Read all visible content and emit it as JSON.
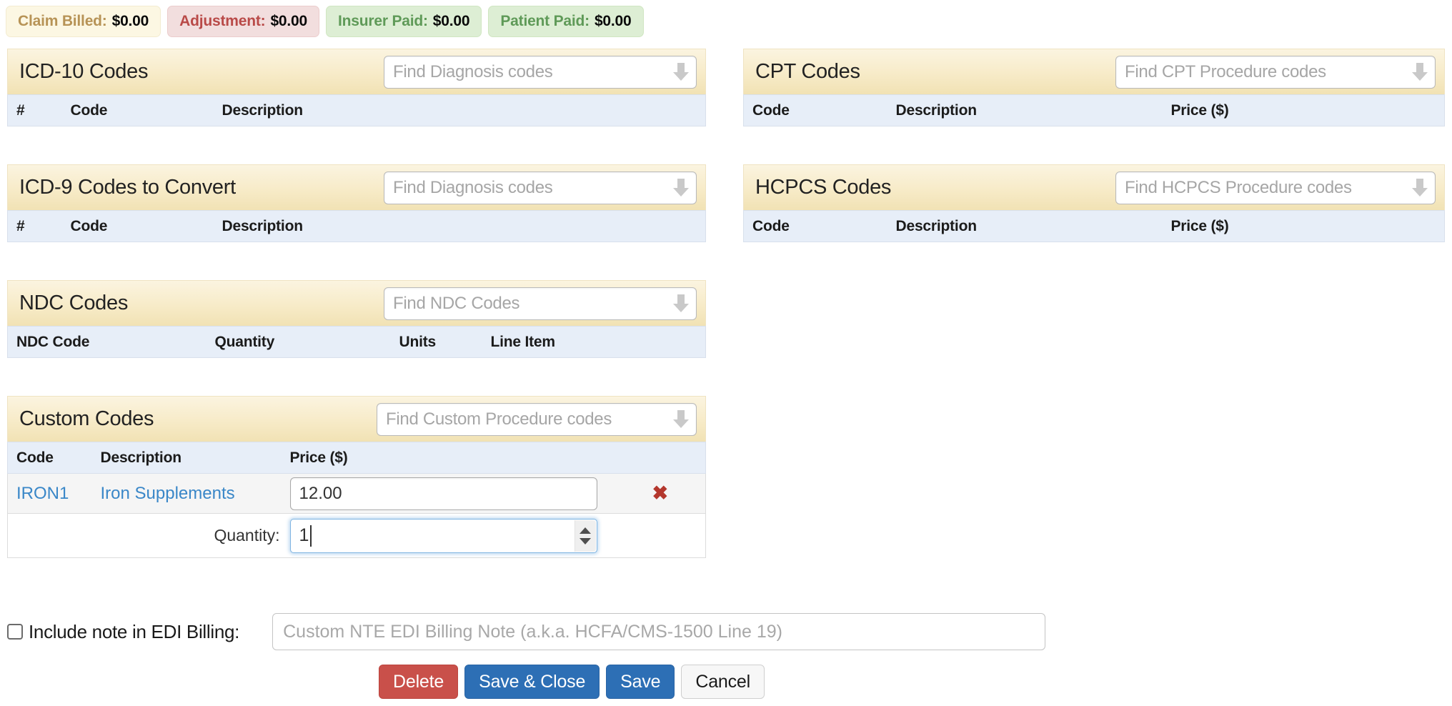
{
  "summary": {
    "badges": [
      {
        "label": "Claim Billed:",
        "amount": "$0.00",
        "tone": "cream",
        "color": "#b79356"
      },
      {
        "label": "Adjustment:",
        "amount": "$0.00",
        "tone": "pink",
        "color": "#b94a48"
      },
      {
        "label": "Insurer Paid:",
        "amount": "$0.00",
        "tone": "green",
        "color": "#5f9a58"
      },
      {
        "label": "Patient Paid:",
        "amount": "$0.00",
        "tone": "green",
        "color": "#5f9a58"
      }
    ]
  },
  "panels": {
    "icd10": {
      "title": "ICD-10 Codes",
      "search_placeholder": "Find Diagnosis codes",
      "columns": [
        "#",
        "Code",
        "Description"
      ],
      "rows": []
    },
    "cpt": {
      "title": "CPT Codes",
      "search_placeholder": "Find CPT Procedure codes",
      "columns": [
        "Code",
        "Description",
        "Price ($)"
      ],
      "rows": []
    },
    "icd9": {
      "title": "ICD-9 Codes to Convert",
      "search_placeholder": "Find Diagnosis codes",
      "columns": [
        "#",
        "Code",
        "Description"
      ],
      "rows": []
    },
    "hcpcs": {
      "title": "HCPCS Codes",
      "search_placeholder": "Find HCPCS Procedure codes",
      "columns": [
        "Code",
        "Description",
        "Price ($)"
      ],
      "rows": []
    },
    "ndc": {
      "title": "NDC Codes",
      "search_placeholder": "Find NDC Codes",
      "columns": [
        "NDC Code",
        "Quantity",
        "Units",
        "Line Item"
      ],
      "rows": []
    },
    "custom": {
      "title": "Custom Codes",
      "search_placeholder": "Find Custom Procedure codes",
      "columns": [
        "Code",
        "Description",
        "Price ($)"
      ],
      "row": {
        "code": "IRON1",
        "description": "Iron Supplements",
        "price": "12.00",
        "remove_glyph": "✖"
      },
      "quantity": {
        "label": "Quantity:",
        "value": "1"
      }
    }
  },
  "edi": {
    "checkbox_label": "Include note in EDI Billing:",
    "note_placeholder": "Custom NTE EDI Billing Note (a.k.a. HCFA/CMS-1500 Line 19)",
    "checked": false
  },
  "footer": {
    "delete_label": "Delete",
    "save_close_label": "Save & Close",
    "save_label": "Save",
    "cancel_label": "Cancel"
  }
}
